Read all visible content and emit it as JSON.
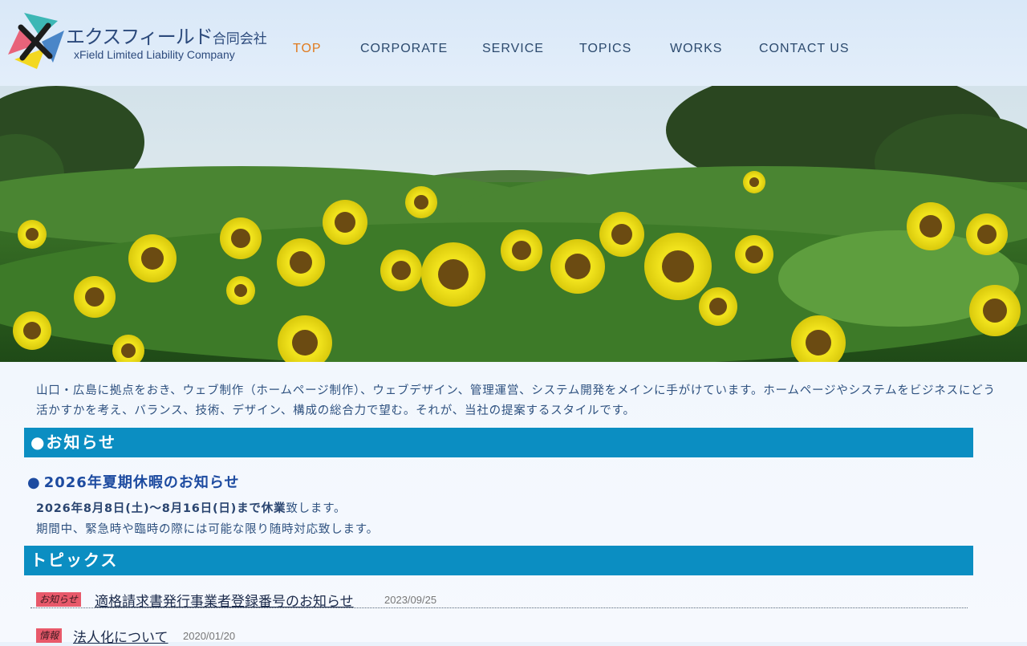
{
  "logo": {
    "name_jp": "エクスフィールド",
    "name_jp_suffix": "合同会社",
    "name_en": "xField Limited Liability Company"
  },
  "nav": {
    "items": [
      {
        "label": "TOP",
        "active": true
      },
      {
        "label": "CORPORATE",
        "active": false
      },
      {
        "label": "SERVICE",
        "active": false
      },
      {
        "label": "TOPICS",
        "active": false
      },
      {
        "label": "WORKS",
        "active": false
      },
      {
        "label": "CONTACT US",
        "active": false
      }
    ]
  },
  "intro": {
    "text": "山口・広島に拠点をおき、ウェブ制作（ホームページ制作）、ウェブデザイン、管理運営、システム開発をメインに手がけています。ホームページやシステムをビジネスにどう活かすかを考え、バランス、技術、デザイン、構成の総合力で望む。それが、当社の提案するスタイルです。"
  },
  "news": {
    "section_title": "●お知らせ",
    "title_bullet": "●",
    "title": "2026年夏期休暇のお知らせ",
    "line1_bold": "2026年8月8日(土)〜8月16日(日)まで休業",
    "line1_rest": "致します。",
    "line2": "期間中、緊急時や臨時の際には可能な限り随時対応致します。"
  },
  "topics": {
    "section_title": "トピックス",
    "items": [
      {
        "badge": "お知らせ",
        "title": "適格請求書発行事業者登録番号のお知らせ",
        "date": "2023/09/25"
      },
      {
        "badge": "情報",
        "title": "法人化について",
        "date": "2020/01/20"
      }
    ]
  },
  "colors": {
    "accent": "#0b8ec2",
    "nav_active": "#e07a1e",
    "badge": "#e8596a",
    "news_title": "#1d4ba0"
  }
}
